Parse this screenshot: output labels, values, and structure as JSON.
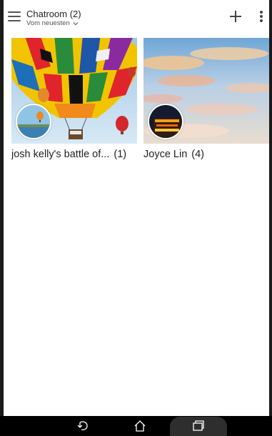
{
  "appbar": {
    "title": "Chatroom (2)",
    "sort_label": "Vom neuesten",
    "icons": [
      "menu-icon",
      "chevron-down-icon",
      "add-icon",
      "more-vert-icon"
    ]
  },
  "albums": [
    {
      "name": "josh kelly's battle of...",
      "count": "(1)",
      "thumbnail": "hot-air-balloon-photo",
      "avatar": "balloon-over-water-photo"
    },
    {
      "name": "Joyce Lin",
      "count": "(4)",
      "thumbnail": "pastel-sunset-sky-photo",
      "avatar": "night-lights-photo"
    }
  ],
  "navbar": {
    "icons": [
      "back-icon",
      "home-icon",
      "recent-apps-icon"
    ]
  },
  "colors": {
    "background": "#ffffff",
    "text": "#222222",
    "navbar": "#000000",
    "icon": "#555555"
  }
}
